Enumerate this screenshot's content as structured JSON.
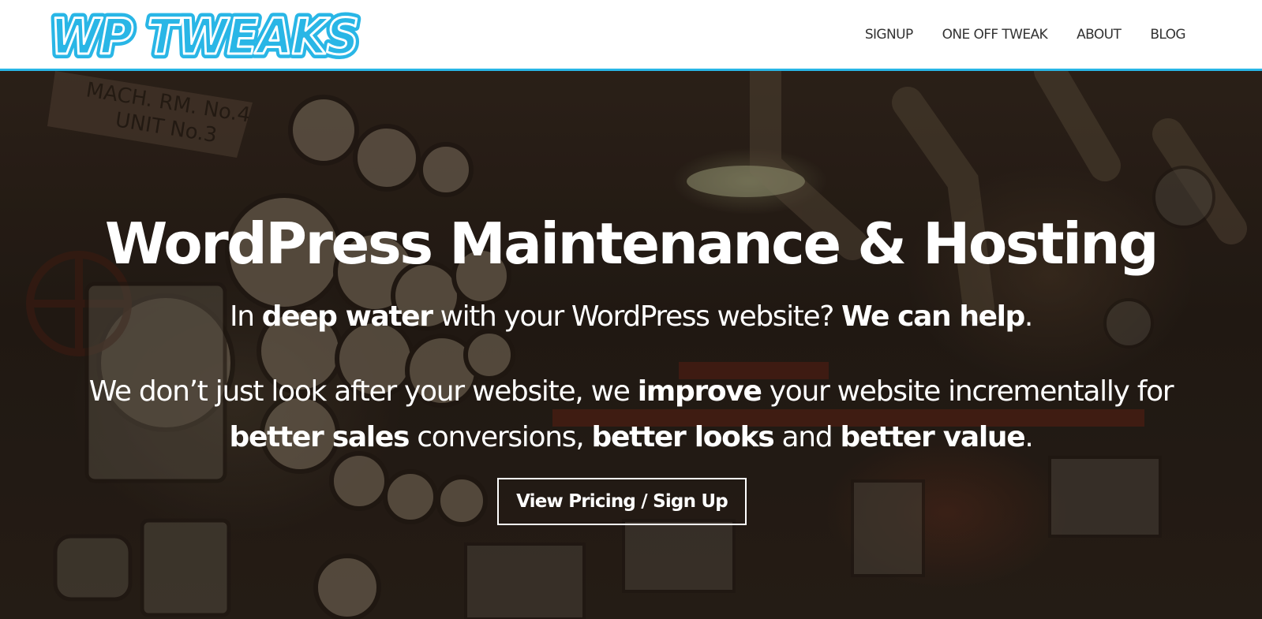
{
  "header": {
    "logo_text": "WP TWEAKS",
    "logo_colors": {
      "fill": "#29b6e6",
      "outline": "#1a8cc0",
      "inner": "#ffffff"
    },
    "nav": [
      {
        "label": "SIGNUP"
      },
      {
        "label": "ONE OFF TWEAK"
      },
      {
        "label": "ABOUT"
      },
      {
        "label": "BLOG"
      }
    ]
  },
  "hero": {
    "title": "WordPress Maintenance & Hosting",
    "subtitle": {
      "t1": "In ",
      "b1": "deep water",
      "t2": " with your WordPress website? ",
      "b2": "We can help",
      "t3": "."
    },
    "description": {
      "t1": "We don’t just look after your website, we ",
      "b1": "improve",
      "t2": " your website incrementally for ",
      "b2": "better sales",
      "t3": " conversions, ",
      "b3": "better looks",
      "t4": " and ",
      "b4": "better value",
      "t5": "."
    },
    "cta_label": "View Pricing / Sign Up",
    "background_image": "machine-room-gauges-photo"
  },
  "colors": {
    "accent": "#29b6e6",
    "header_bg": "#ffffff",
    "nav_text": "#333333",
    "hero_text": "#ffffff"
  }
}
